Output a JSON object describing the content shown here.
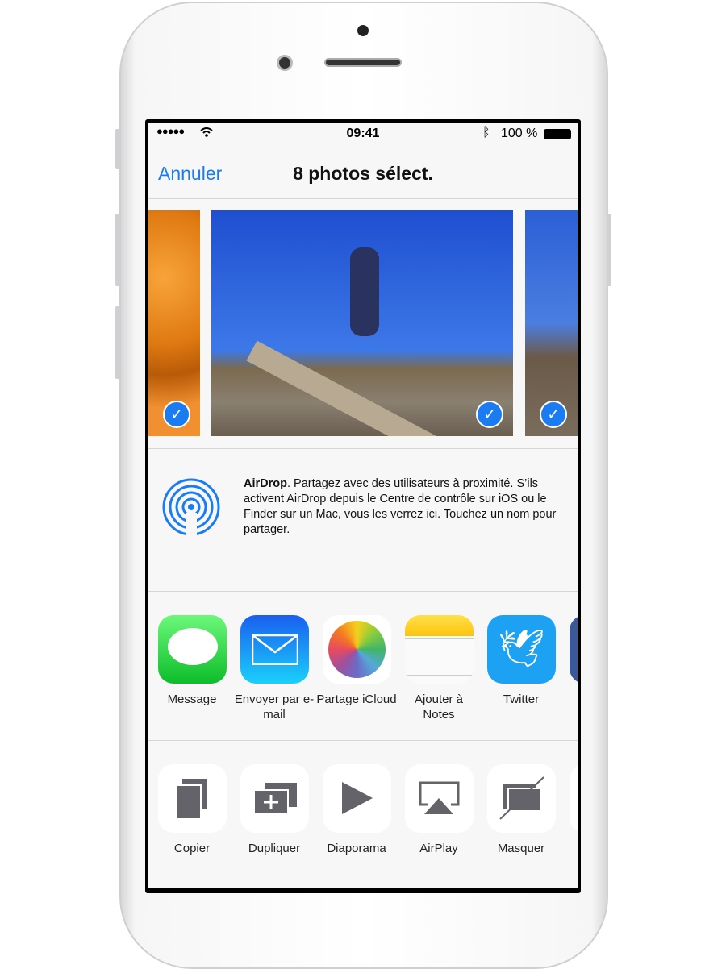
{
  "status": {
    "time": "09:41",
    "battery": "100 %",
    "signal_dots": 5,
    "battery_level": 1.0
  },
  "nav": {
    "cancel": "Annuler",
    "title": "8 photos sélect."
  },
  "photos": [
    {
      "selected": true
    },
    {
      "selected": true
    },
    {
      "selected": true
    }
  ],
  "airdrop": {
    "title": "AirDrop",
    "text": ". Partagez avec des utilisateurs à proximité. S’ils activent AirDrop depuis le Centre de contrôle sur iOS ou le Finder sur un Mac, vous les verrez ici. Touchez un nom pour partager."
  },
  "apps": [
    {
      "label": "Message",
      "icon": "messages-icon"
    },
    {
      "label": "Envoyer par e-mail",
      "icon": "mail-icon"
    },
    {
      "label": "Partage iCloud",
      "icon": "photos-icon"
    },
    {
      "label": "Ajouter à Notes",
      "icon": "notes-icon"
    },
    {
      "label": "Twitter",
      "icon": "twitter-icon"
    }
  ],
  "actions": [
    {
      "label": "Copier",
      "icon": "copy-icon"
    },
    {
      "label": "Dupliquer",
      "icon": "duplicate-icon"
    },
    {
      "label": "Diaporama",
      "icon": "play-icon"
    },
    {
      "label": "AirPlay",
      "icon": "airplay-icon"
    },
    {
      "label": "Masquer",
      "icon": "hide-icon"
    }
  ],
  "colors": {
    "accent": "#1a7cf0",
    "action_icon": "#636369"
  }
}
